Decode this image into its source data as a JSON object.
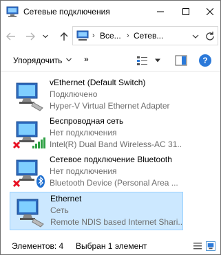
{
  "window": {
    "title": "Сетевые подключения",
    "icons": {
      "app": "network-connections-icon",
      "minimize": "minimize-icon",
      "maximize": "maximize-icon",
      "close": "close-icon"
    }
  },
  "nav": {
    "breadcrumb": [
      "Все...",
      "Сетев..."
    ],
    "separator": "›",
    "icons": {
      "back": "back-arrow-icon",
      "forward": "forward-arrow-icon",
      "recent": "chevron-down-icon",
      "up": "up-arrow-icon",
      "refresh": "refresh-icon"
    }
  },
  "commands": {
    "organize": "Упорядочить",
    "more": "»",
    "help": "?",
    "icons": {
      "organize_dd": "chevron-down-icon",
      "view": "change-view-icon",
      "preview": "preview-pane-icon",
      "help": "help-icon"
    }
  },
  "connections": [
    {
      "name": "vEthernet (Default Switch)",
      "status": "Подключено",
      "device": "Hyper-V Virtual Ethernet Adapter",
      "badge": "none",
      "selected": false
    },
    {
      "name": "Беспроводная сеть",
      "status": "Нет подключения",
      "device": "Intel(R) Dual Band Wireless-AC 31...",
      "badge": "disconnected-x-icon",
      "extra": "wifi-signal-icon",
      "selected": false
    },
    {
      "name": "Сетевое подключение Bluetooth",
      "status": "Нет подключения",
      "device": "Bluetooth Device (Personal Area ...",
      "badge": "disconnected-x-icon",
      "extra": "bluetooth-icon",
      "selected": false
    },
    {
      "name": "Ethernet",
      "status": "Сеть",
      "device": "Remote NDIS based Internet Shari...",
      "badge": "none",
      "selected": true
    }
  ],
  "status": {
    "count": "Элементов: 4",
    "selected": "Выбран 1 элемент",
    "icons": {
      "details_view": "details-view-icon",
      "large_icons_view": "large-icons-view-icon"
    }
  },
  "colors": {
    "selection_bg": "#cce8ff",
    "selection_border": "#99d1ff",
    "help": "#2b79d9",
    "status_x": "#e81123",
    "signal": "#2ea043",
    "bluetooth": "#1f6fd0"
  }
}
